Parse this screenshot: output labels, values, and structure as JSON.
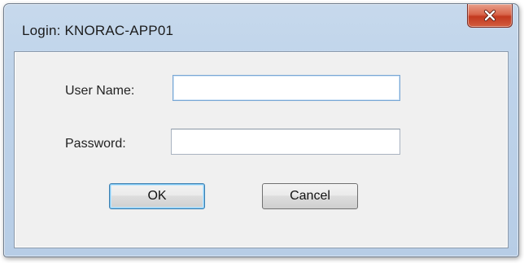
{
  "window": {
    "title": "Login: KNORAC-APP01",
    "close_icon": "close-x-icon"
  },
  "form": {
    "username_label": "User Name:",
    "username_value": "",
    "password_label": "Password:",
    "password_value": ""
  },
  "buttons": {
    "ok_label": "OK",
    "cancel_label": "Cancel"
  },
  "colors": {
    "titlebar": "#bed3ea",
    "close_button": "#c2391f",
    "client_background": "#f0f0f0",
    "focus_border": "#3c7fb1"
  }
}
